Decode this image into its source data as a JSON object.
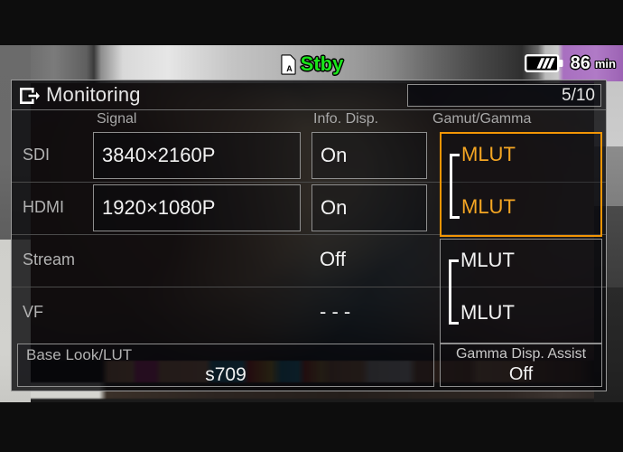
{
  "status_bar": {
    "card_icon": "sd-card-a-icon",
    "recording_status": "Stby",
    "recording_status_color": "#19e519",
    "battery_icon": "battery-icon",
    "battery_minutes": "86",
    "battery_unit": "min"
  },
  "menu": {
    "exit_icon": "exit-arrow-icon",
    "title": "Monitoring",
    "page_indicator": "5/10",
    "columns": {
      "signal": "Signal",
      "info_disp": "Info. Disp.",
      "gamut_gamma": "Gamut/Gamma"
    },
    "rows": [
      {
        "label": "SDI",
        "signal": "3840×2160P",
        "signal_boxed": true,
        "info_disp": "On",
        "info_boxed": true
      },
      {
        "label": "HDMI",
        "signal": "1920×1080P",
        "signal_boxed": true,
        "info_disp": "On",
        "info_boxed": true
      },
      {
        "label": "Stream",
        "signal": "",
        "signal_boxed": false,
        "info_disp": "Off",
        "info_boxed": false
      },
      {
        "label": "VF",
        "signal": "",
        "signal_boxed": false,
        "info_disp": "- - -",
        "info_boxed": false
      }
    ],
    "gamut_groups": [
      {
        "name": "sdi-hdmi",
        "selected": true,
        "top_value": "MLUT",
        "bottom_value": "MLUT",
        "color": "#f5a623"
      },
      {
        "name": "stream-vf",
        "selected": false,
        "top_value": "MLUT",
        "bottom_value": "MLUT",
        "color": "#f2f2f2"
      }
    ],
    "base_look": {
      "label": "Base Look/LUT",
      "value": "s709"
    },
    "gamma_assist": {
      "label": "Gamma Disp. Assist",
      "value": "Off"
    },
    "selection_color": "#f29505"
  }
}
